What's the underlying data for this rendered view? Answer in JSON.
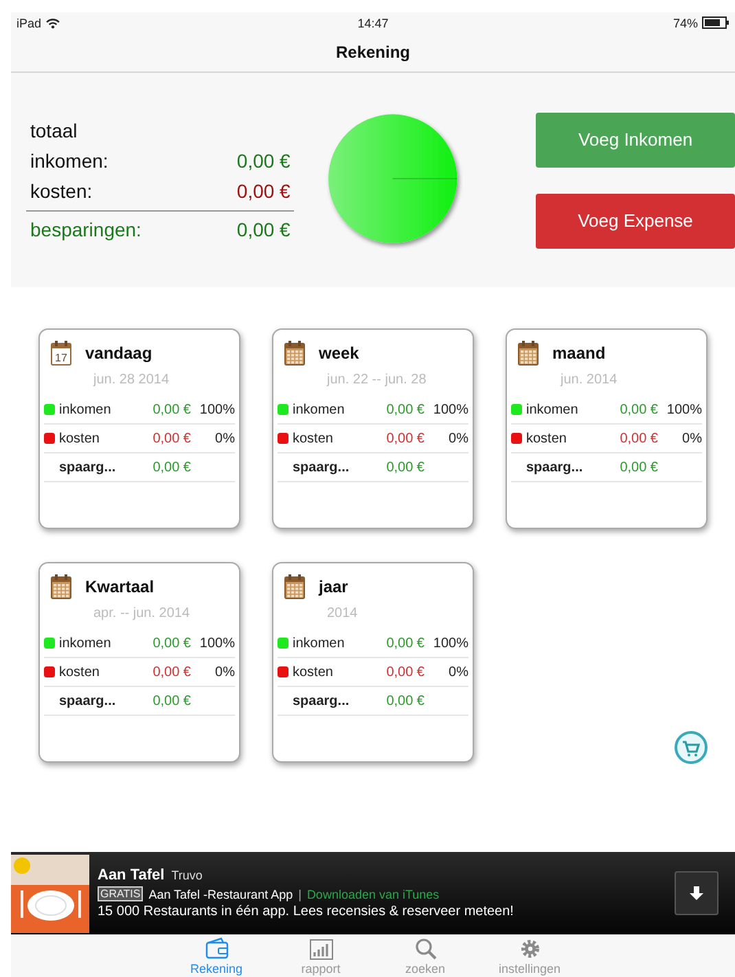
{
  "status_bar": {
    "device": "iPad",
    "time": "14:47",
    "battery": "74%"
  },
  "nav_bar": {
    "title": "Rekening"
  },
  "summary": {
    "heading": "totaal",
    "rows": [
      {
        "kind": "income",
        "label": "inkomen:",
        "amount": "0,00 €"
      },
      {
        "kind": "cost",
        "label": "kosten:",
        "amount": "0,00 €"
      },
      {
        "kind": "savings",
        "label": "besparingen:",
        "amount": "0,00 €"
      }
    ],
    "buttons": [
      {
        "kind": "income",
        "label": "Voeg Inkomen"
      },
      {
        "kind": "cost",
        "label": "Voeg Expense"
      }
    ]
  },
  "cards": [
    {
      "title": "vandaag",
      "subtitle": "jun. 28 2014",
      "icon_number": "17",
      "rows": [
        {
          "kind": "income",
          "label": "inkomen",
          "amount": "0,00 €",
          "percent": "100%",
          "color": "#1ee81e"
        },
        {
          "kind": "cost",
          "label": "kosten",
          "amount": "0,00 €",
          "percent": "0%",
          "color": "#e81010"
        },
        {
          "kind": "savings",
          "label": "spaarg...",
          "amount": "0,00 €"
        }
      ]
    },
    {
      "title": "week",
      "subtitle": "jun. 22 -- jun. 28",
      "rows": [
        {
          "kind": "income",
          "label": "inkomen",
          "amount": "0,00 €",
          "percent": "100%",
          "color": "#1ee81e"
        },
        {
          "kind": "cost",
          "label": "kosten",
          "amount": "0,00 €",
          "percent": "0%",
          "color": "#e81010"
        },
        {
          "kind": "savings",
          "label": "spaarg...",
          "amount": "0,00 €"
        }
      ]
    },
    {
      "title": "maand",
      "subtitle": "jun. 2014",
      "rows": [
        {
          "kind": "income",
          "label": "inkomen",
          "amount": "0,00 €",
          "percent": "100%",
          "color": "#1ee81e"
        },
        {
          "kind": "cost",
          "label": "kosten",
          "amount": "0,00 €",
          "percent": "0%",
          "color": "#e81010"
        },
        {
          "kind": "savings",
          "label": "spaarg...",
          "amount": "0,00 €"
        }
      ]
    },
    {
      "title": "Kwartaal",
      "subtitle": "apr. -- jun. 2014",
      "rows": [
        {
          "kind": "income",
          "label": "inkomen",
          "amount": "0,00 €",
          "percent": "100%",
          "color": "#1ee81e"
        },
        {
          "kind": "cost",
          "label": "kosten",
          "amount": "0,00 €",
          "percent": "0%",
          "color": "#e81010"
        },
        {
          "kind": "savings",
          "label": "spaarg...",
          "amount": "0,00 €"
        }
      ]
    },
    {
      "title": "jaar",
      "subtitle": "2014",
      "rows": [
        {
          "kind": "income",
          "label": "inkomen",
          "amount": "0,00 €",
          "percent": "100%",
          "color": "#1ee81e"
        },
        {
          "kind": "cost",
          "label": "kosten",
          "amount": "0,00 €",
          "percent": "0%",
          "color": "#e81010"
        },
        {
          "kind": "savings",
          "label": "spaarg...",
          "amount": "0,00 €"
        }
      ]
    }
  ],
  "ad": {
    "title": "Aan Tafel",
    "developer": "Truvo",
    "badge": "GRATIS",
    "app_name": "Aan Tafel -Restaurant App",
    "separator": "|",
    "link": "Downloaden van iTunes",
    "description": "15 000 Restaurants in één app. Lees recensies & reserveer meteen!"
  },
  "tab_bar": [
    {
      "kind": "wallet",
      "label": "Rekening",
      "selected": true
    },
    {
      "kind": "chart",
      "label": "rapport",
      "selected": false
    },
    {
      "kind": "search",
      "label": "zoeken",
      "selected": false
    },
    {
      "kind": "gear",
      "label": "instellingen",
      "selected": false
    }
  ]
}
